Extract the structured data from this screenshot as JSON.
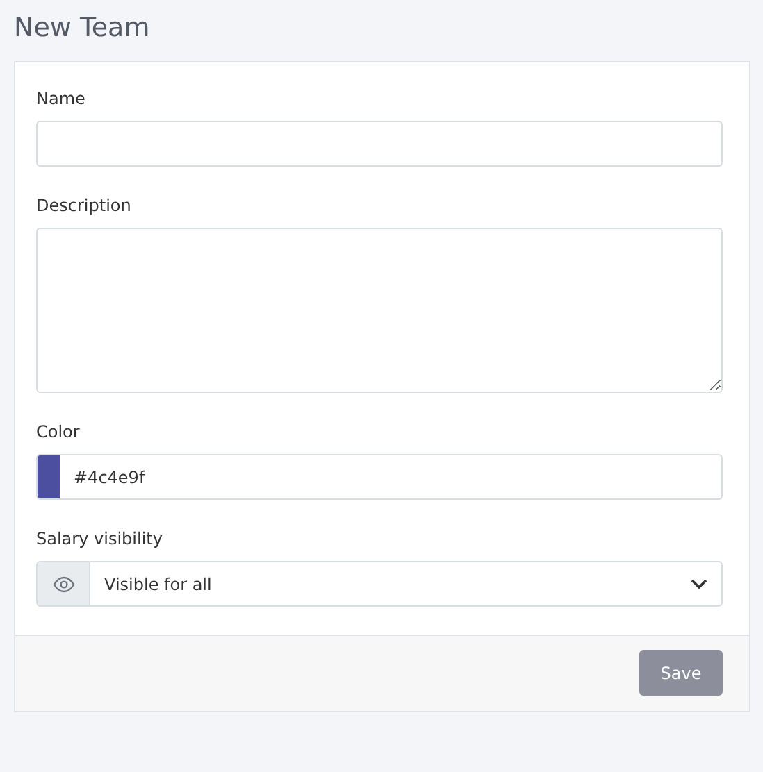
{
  "page": {
    "title": "New Team"
  },
  "fields": [
    {
      "kind": "text",
      "label": "Name"
    },
    {
      "kind": "textarea",
      "label": "Description"
    },
    {
      "kind": "color",
      "label": "Color",
      "value": "#4c4e9f"
    },
    {
      "kind": "select",
      "label": "Salary visibility",
      "value": "Visible for all"
    }
  ],
  "buttons": [
    {
      "label": "Save",
      "disabled": true
    }
  ]
}
